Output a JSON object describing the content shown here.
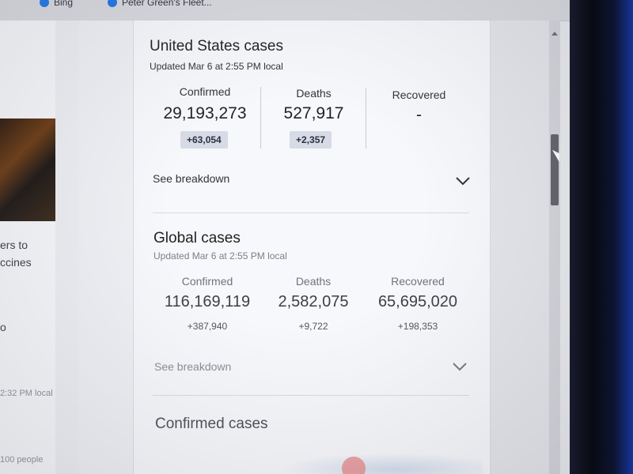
{
  "bookmarks": [
    {
      "label": "Bing"
    },
    {
      "label": "Peter Green's Fleet..."
    }
  ],
  "left_panel": {
    "line1": "ers to",
    "line2": "ccines",
    "line3": "o",
    "timestamp": "2:32 PM local",
    "people": "100 people"
  },
  "us_cases": {
    "title": "United States cases",
    "updated": "Updated Mar 6 at 2:55 PM local",
    "confirmed": {
      "label": "Confirmed",
      "value": "29,193,273",
      "delta": "+63,054"
    },
    "deaths": {
      "label": "Deaths",
      "value": "527,917",
      "delta": "+2,357"
    },
    "recovered": {
      "label": "Recovered",
      "value": "-"
    },
    "breakdown_label": "See breakdown"
  },
  "global_cases": {
    "title": "Global cases",
    "updated": "Updated Mar 6 at 2:55 PM local",
    "confirmed": {
      "label": "Confirmed",
      "value": "116,169,119",
      "delta": "+387,940"
    },
    "deaths": {
      "label": "Deaths",
      "value": "2,582,075",
      "delta": "+9,722"
    },
    "recovered": {
      "label": "Recovered",
      "value": "65,695,020",
      "delta": "+198,353"
    },
    "breakdown_label": "See breakdown"
  },
  "confirmed_cases": {
    "title": "Confirmed cases"
  },
  "icons": {
    "bookmark": "bing-icon",
    "expand": "chevron-down-icon"
  },
  "colors": {
    "chip_bg": "#d7dbe6",
    "accent": "#1a73e8"
  }
}
